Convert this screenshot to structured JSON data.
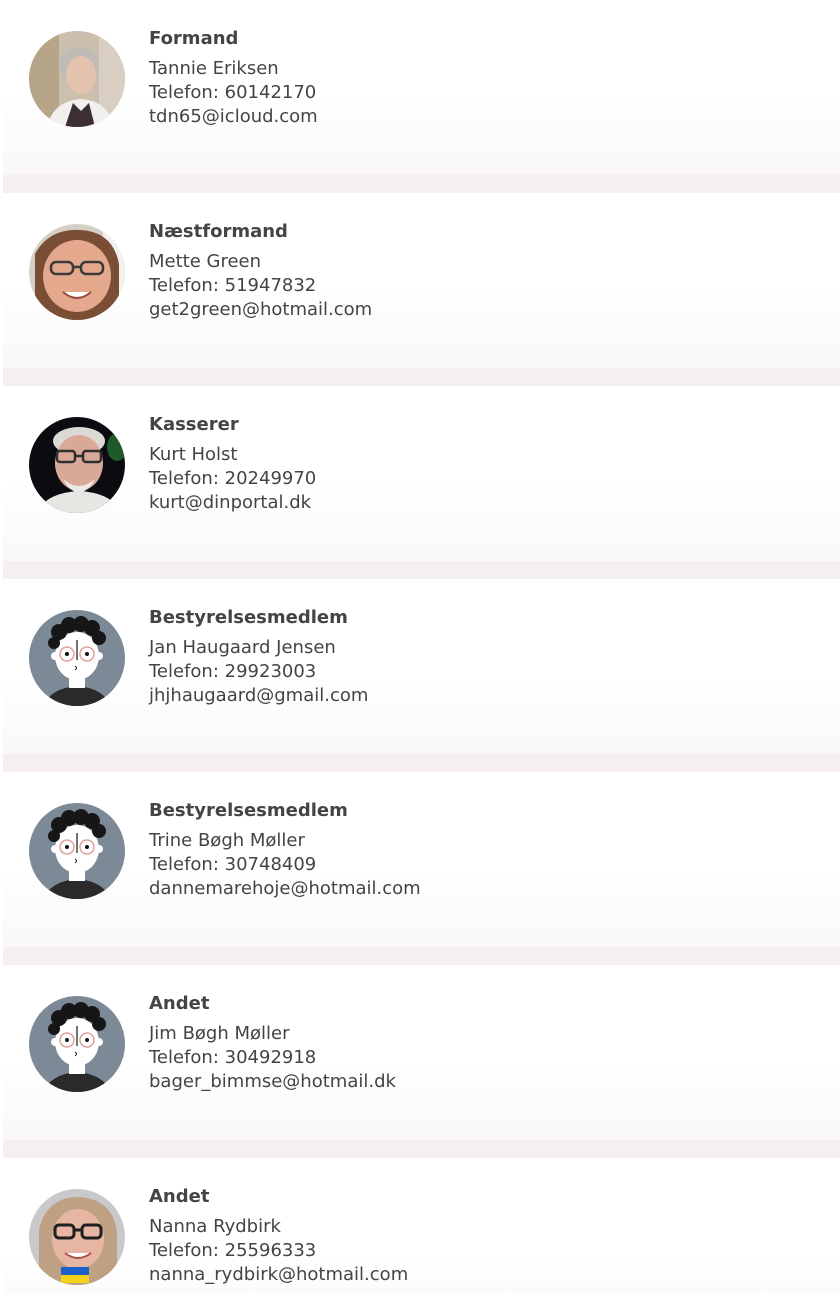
{
  "members": [
    {
      "role": "Formand",
      "name": "Tannie Eriksen",
      "phone": "Telefon: 60142170",
      "email": "tdn65@icloud.com",
      "avatar": "photo-woman-grey-hair"
    },
    {
      "role": "Næstformand",
      "name": "Mette Green",
      "phone": "Telefon: 51947832",
      "email": "get2green@hotmail.com",
      "avatar": "photo-woman-glasses"
    },
    {
      "role": "Kasserer",
      "name": "Kurt Holst",
      "phone": "Telefon: 20249970",
      "email": "kurt@dinportal.dk",
      "avatar": "photo-man-glasses"
    },
    {
      "role": "Bestyrelsesmedlem",
      "name": "Jan Haugaard Jensen",
      "phone": "Telefon: 29923003",
      "email": "jhjhaugaard@gmail.com",
      "avatar": "cartoon-placeholder"
    },
    {
      "role": "Bestyrelsesmedlem",
      "name": "Trine Bøgh Møller",
      "phone": "Telefon: 30748409",
      "email": "dannemarehoje@hotmail.com",
      "avatar": "cartoon-placeholder"
    },
    {
      "role": "Andet",
      "name": "Jim Bøgh Møller",
      "phone": "Telefon: 30492918",
      "email": "bager_bimmse@hotmail.dk",
      "avatar": "cartoon-placeholder"
    },
    {
      "role": "Andet",
      "name": "Nanna Rydbirk",
      "phone": "Telefon: 25596333",
      "email": "nanna_rydbirk@hotmail.com",
      "avatar": "photo-woman-glasses-ukraine-flag"
    }
  ],
  "colors": {
    "text": "#444444",
    "separator": "#f5eff2",
    "avatar_bg": "#7b8a96"
  }
}
